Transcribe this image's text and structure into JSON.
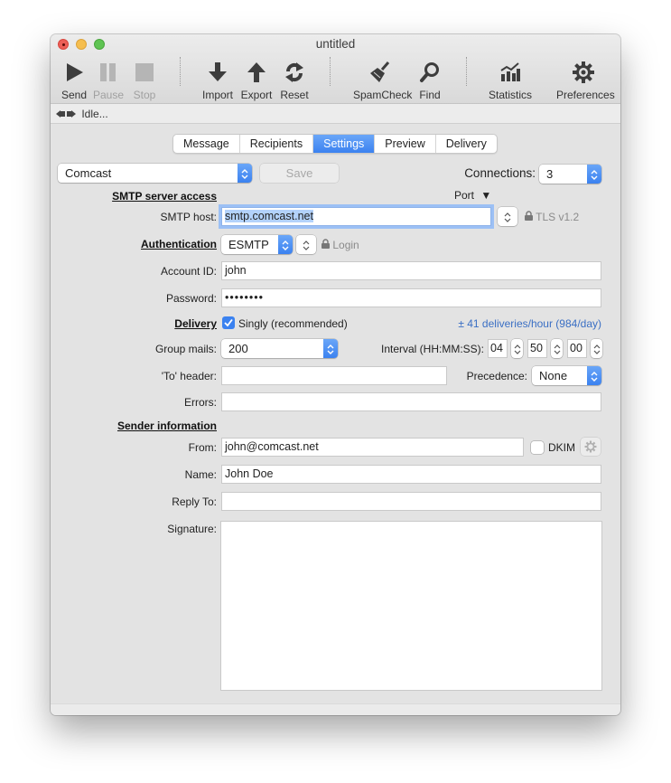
{
  "window": {
    "title": "untitled"
  },
  "toolbar": {
    "send": "Send",
    "pause": "Pause",
    "stop": "Stop",
    "import": "Import",
    "export": "Export",
    "reset": "Reset",
    "spamcheck": "SpamCheck",
    "find": "Find",
    "statistics": "Statistics",
    "preferences": "Preferences"
  },
  "status": {
    "text": "Idle..."
  },
  "tabs": [
    {
      "label": "Message",
      "active": false
    },
    {
      "label": "Recipients",
      "active": false
    },
    {
      "label": "Settings",
      "active": true
    },
    {
      "label": "Preview",
      "active": false
    },
    {
      "label": "Delivery",
      "active": false
    }
  ],
  "settings": {
    "account_preset": "Comcast",
    "save_label": "Save",
    "connections_label": "Connections:",
    "connections_value": "3",
    "smtp_section": "SMTP server access",
    "port_label": "Port",
    "port_arrow": "▼",
    "smtp_host_label": "SMTP host:",
    "smtp_host_value": "smtp.comcast.net",
    "tls_label": "TLS v1.2",
    "auth_section": "Authentication",
    "auth_value": "ESMTP",
    "login_label": "Login",
    "account_id_label": "Account ID:",
    "account_id_value": "john",
    "password_label": "Password:",
    "password_value": "••••••••",
    "delivery_section": "Delivery",
    "singly_label": "Singly (recommended)",
    "singly_checked": true,
    "rate_text": "± 41 deliveries/hour (984/day)",
    "group_mails_label": "Group mails:",
    "group_mails_value": "200",
    "interval_label": "Interval (HH:MM:SS):",
    "interval_hh": "04",
    "interval_mm": "50",
    "interval_ss": "00",
    "to_header_label": "'To' header:",
    "to_header_value": "",
    "precedence_label": "Precedence:",
    "precedence_value": "None",
    "errors_label": "Errors:",
    "errors_value": "",
    "sender_section": "Sender information",
    "from_label": "From:",
    "from_value": "john@comcast.net",
    "dkim_label": "DKIM",
    "dkim_checked": false,
    "name_label": "Name:",
    "name_value": "John Doe",
    "reply_to_label": "Reply To:",
    "reply_to_value": "",
    "signature_label": "Signature:",
    "signature_value": ""
  },
  "colors": {
    "accent": "#3b82f0",
    "rate_text": "#3a6fc4"
  }
}
